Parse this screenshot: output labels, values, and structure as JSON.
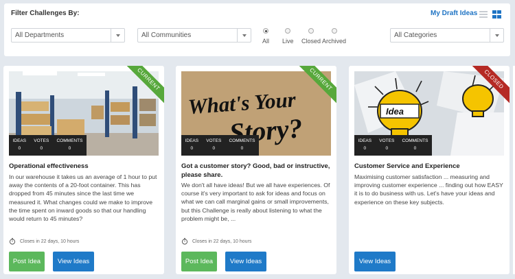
{
  "filter": {
    "title": "Filter Challenges By:",
    "draft_link": "My Draft Ideas",
    "view_list_icon": "list-view-icon",
    "view_grid_icon": "grid-view-icon",
    "departments": "All Departments",
    "communities": "All Communities",
    "categories": "All Categories",
    "status_options": [
      {
        "label": "All",
        "selected": true
      },
      {
        "label": "Live",
        "selected": false
      },
      {
        "label": "Closed",
        "selected": false
      },
      {
        "label": "Archived",
        "selected": false
      }
    ]
  },
  "colors": {
    "accent": "#1f74c4",
    "green": "#5cb85c",
    "current_ribbon": "#57a83b",
    "closed_ribbon": "#b52a25"
  },
  "cards": [
    {
      "ribbon": "CURRENT",
      "image_icon": "warehouse-photo",
      "stats": {
        "ideas_label": "IDEAS",
        "ideas": "0",
        "votes_label": "VOTES",
        "votes": "0",
        "comments_label": "COMMENTS",
        "comments": "0"
      },
      "title": "Operational effectiveness",
      "description": "In our warehouse it takes us an average of 1 hour to put away the contents of a 20-foot container. This has dropped from 45 minutes since the last time we measured it. What changes could we make to improve the time spent on inward goods so that our handling would return to 45 minutes?",
      "closes": "Closes in 22 days, 10 hours",
      "post_label": "Post Idea",
      "view_label": "View Ideas"
    },
    {
      "ribbon": "CURRENT",
      "image_icon": "whats-your-story-photo",
      "image_text_1": "What's Your",
      "image_text_2": "Story?",
      "stats": {
        "ideas_label": "IDEAS",
        "ideas": "0",
        "votes_label": "VOTES",
        "votes": "0",
        "comments_label": "COMMENTS",
        "comments": "0"
      },
      "title": "Got a customer story? Good, bad or instructive, please share.",
      "description": "We don't all have ideas! But we all have experiences. Of course it's very important to ask for ideas and focus on what we can call marginal gains or small improvements, but this Challenge is really about listening to what the problem might be, ...",
      "closes": "Closes in 22 days, 10 hours",
      "post_label": "Post Idea",
      "view_label": "View Ideas"
    },
    {
      "ribbon": "CLOSED",
      "image_icon": "idea-lightbulb-photo",
      "image_text": "Idea",
      "stats": {
        "ideas_label": "IDEAS",
        "ideas": "0",
        "votes_label": "VOTES",
        "votes": "0",
        "comments_label": "COMMENTS",
        "comments": "0"
      },
      "title": "Customer Service and Experience",
      "description": "Maximising customer satisfaction ... measuring and improving customer experience ... finding out how EASY it is to do business with us. Let's have your ideas and experience on these key subjects.",
      "view_label": "View Ideas"
    }
  ]
}
